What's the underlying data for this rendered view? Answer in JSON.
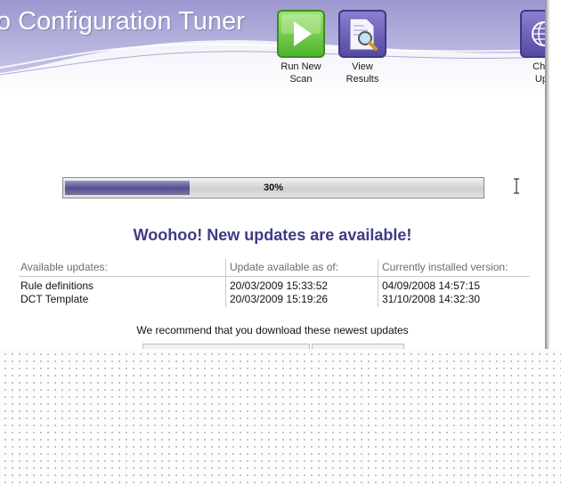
{
  "app": {
    "title": "o Configuration Tuner"
  },
  "toolbar": {
    "run_new_scan": {
      "label_line1": "Run New",
      "label_line2": "Scan",
      "icon": "play-icon"
    },
    "view_results": {
      "label_line1": "View",
      "label_line2": "Results",
      "icon": "magnifier-document-icon"
    },
    "check_updates": {
      "label_line1": "Chec",
      "label_line2": "Upd",
      "icon": "globe-icon"
    }
  },
  "progress": {
    "value": 0.3,
    "text": "30%"
  },
  "headline": "Woohoo! New updates are available!",
  "updates": {
    "headers": [
      "Available updates:",
      "Update available as of:",
      "Currently installed version:"
    ],
    "rows": [
      [
        "Rule definitions",
        "20/03/2009 15:33:52",
        "04/09/2008 14:57:15"
      ],
      [
        "DCT Template",
        "20/03/2009 15:19:26",
        "31/10/2008 14:32:30"
      ]
    ]
  },
  "recommendation": "We recommend that you download these newest updates",
  "colors": {
    "accent": "#3e3b86",
    "header_bg": "#a9a6d6",
    "progress_fill": "#53508f",
    "run_icon": "#5cc03a"
  }
}
